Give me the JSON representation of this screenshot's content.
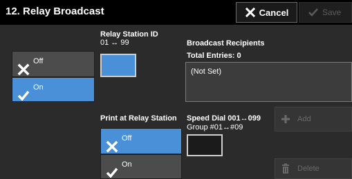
{
  "header": {
    "title": "12. Relay Broadcast",
    "cancel_label": "Cancel",
    "save_label": "Save"
  },
  "relay_station": {
    "label": "Relay Station ID",
    "range": "01 ↔ 99",
    "options": [
      {
        "label": "Off",
        "selected": false
      },
      {
        "label": "On",
        "selected": true
      }
    ]
  },
  "broadcast": {
    "label": "Broadcast Recipients",
    "total": "Total Entries: 0",
    "recipients_value": "(Not Set)"
  },
  "print_at_relay": {
    "label": "Print at Relay Station",
    "options": [
      {
        "label": "Off",
        "selected": true
      },
      {
        "label": "On",
        "selected": false
      }
    ]
  },
  "speed_dial": {
    "label": "Speed Dial 001↔099",
    "group": "Group #01↔#09",
    "add_label": "Add",
    "delete_label": "Delete"
  },
  "colors": {
    "selected": "#4a90d9",
    "unselected": "#4c4c4c",
    "header": "#000000",
    "background": "#2b2b2b"
  },
  "icons": {
    "cancel": "close-x-icon",
    "save": "checkmark-icon",
    "off": "close-x-icon",
    "on": "checkmark-icon",
    "add": "plus-icon",
    "delete": "trash-icon"
  }
}
